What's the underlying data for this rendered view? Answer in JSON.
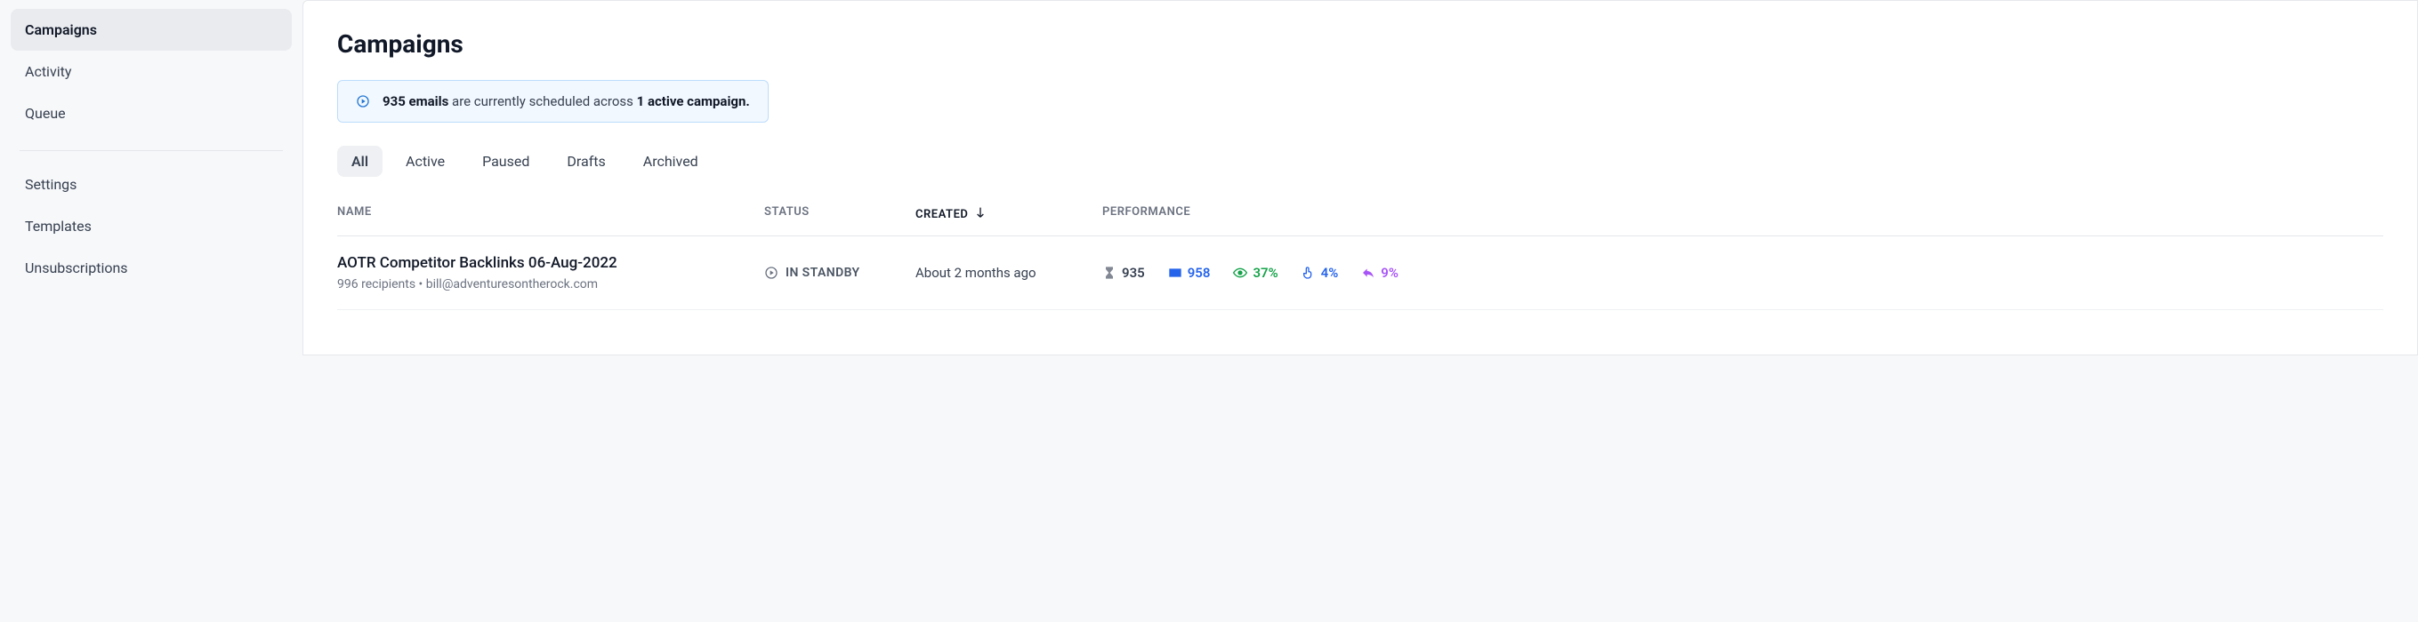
{
  "sidebar": {
    "items": [
      {
        "label": "Campaigns",
        "active": true
      },
      {
        "label": "Activity",
        "active": false
      },
      {
        "label": "Queue",
        "active": false
      }
    ],
    "secondary": [
      {
        "label": "Settings"
      },
      {
        "label": "Templates"
      },
      {
        "label": "Unsubscriptions"
      }
    ]
  },
  "page": {
    "title": "Campaigns"
  },
  "banner": {
    "emails_count": "935 emails",
    "middle_text": " are currently scheduled across ",
    "campaigns_text": "1 active campaign."
  },
  "tabs": [
    {
      "label": "All",
      "active": true
    },
    {
      "label": "Active",
      "active": false
    },
    {
      "label": "Paused",
      "active": false
    },
    {
      "label": "Drafts",
      "active": false
    },
    {
      "label": "Archived",
      "active": false
    }
  ],
  "table": {
    "headers": {
      "name": "NAME",
      "status": "STATUS",
      "created": "CREATED",
      "performance": "PERFORMANCE"
    },
    "rows": [
      {
        "title": "AOTR Competitor Backlinks 06-Aug-2022",
        "subtitle": "996 recipients • bill@adventuresontherock.com",
        "status": "IN STANDBY",
        "created": "About 2 months ago",
        "perf": {
          "queued": "935",
          "sent": "958",
          "open": "37%",
          "click": "4%",
          "reply": "9%"
        }
      }
    ]
  }
}
